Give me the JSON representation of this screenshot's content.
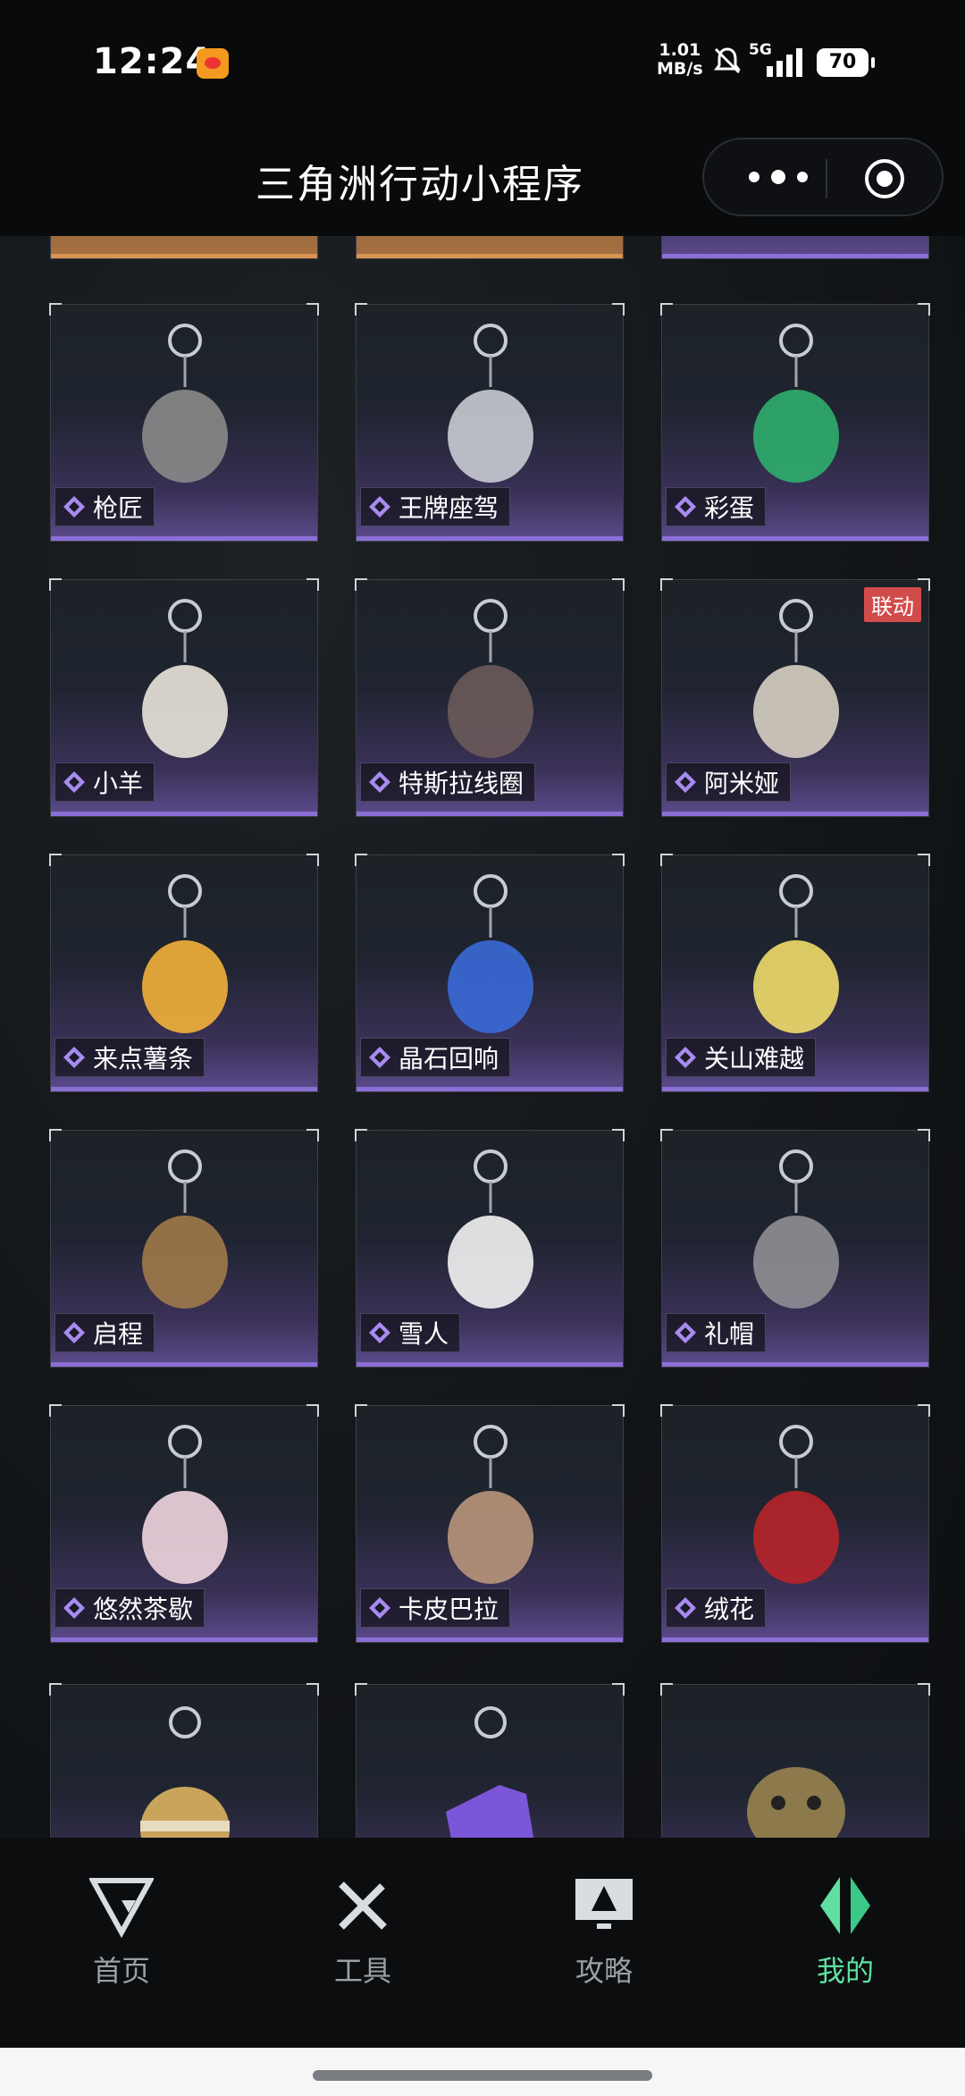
{
  "status_bar": {
    "time": "12:24",
    "speed_value": "1.01",
    "speed_unit": "MB/s",
    "network": "5G",
    "battery": "70"
  },
  "title_bar": {
    "title": "三角洲行动小程序"
  },
  "grid": {
    "items": [
      {
        "label": "枪匠",
        "tag": ""
      },
      {
        "label": "王牌座驾",
        "tag": ""
      },
      {
        "label": "彩蛋",
        "tag": ""
      },
      {
        "label": "小羊",
        "tag": ""
      },
      {
        "label": "特斯拉线圈",
        "tag": ""
      },
      {
        "label": "阿米娅",
        "tag": "联动"
      },
      {
        "label": "来点薯条",
        "tag": ""
      },
      {
        "label": "晶石回响",
        "tag": ""
      },
      {
        "label": "关山难越",
        "tag": ""
      },
      {
        "label": "启程",
        "tag": ""
      },
      {
        "label": "雪人",
        "tag": ""
      },
      {
        "label": "礼帽",
        "tag": ""
      },
      {
        "label": "悠然茶歇",
        "tag": ""
      },
      {
        "label": "卡皮巴拉",
        "tag": ""
      },
      {
        "label": "绒花",
        "tag": ""
      }
    ]
  },
  "tab_bar": {
    "tabs": [
      {
        "label": "首页",
        "icon": "delta-logo-icon",
        "active": false
      },
      {
        "label": "工具",
        "icon": "tools-icon",
        "active": false
      },
      {
        "label": "攻略",
        "icon": "monitor-guide-icon",
        "active": false
      },
      {
        "label": "我的",
        "icon": "profile-logo-icon",
        "active": true
      }
    ]
  },
  "colors": {
    "accent_active": "#5fe0a0",
    "card_purple": "#8b6fd6",
    "tag_red": "#d24b4b"
  }
}
